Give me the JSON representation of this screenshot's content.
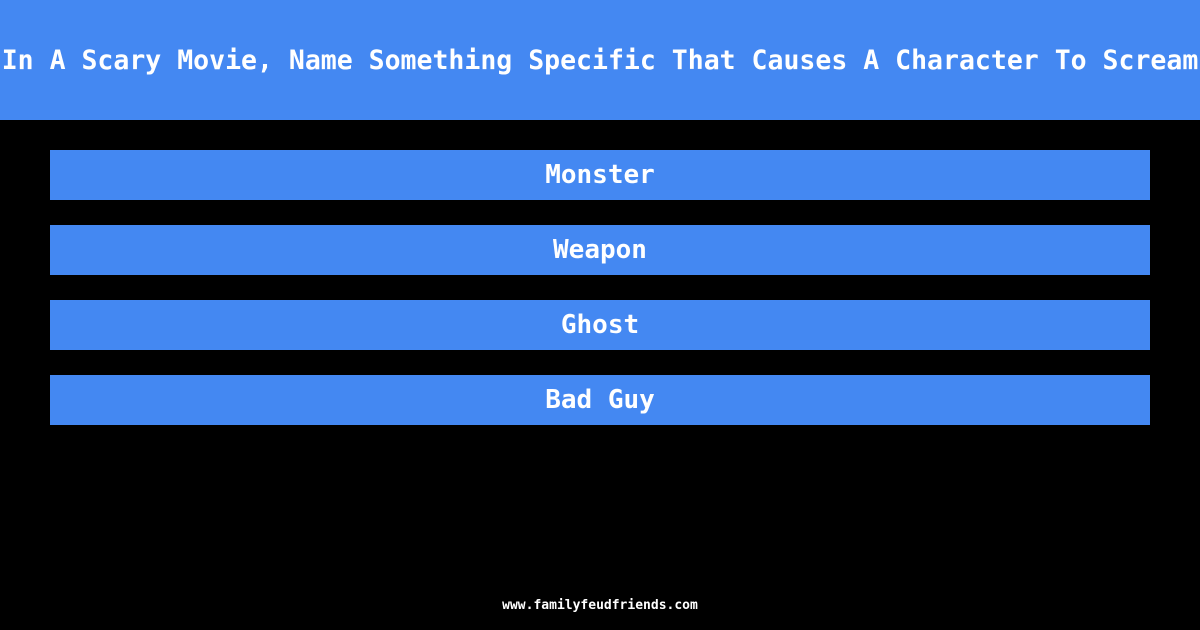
{
  "header": {
    "title": "In A Scary Movie, Name Something Specific That Causes A Character To Scream"
  },
  "answers": [
    {
      "label": "Monster"
    },
    {
      "label": "Weapon"
    },
    {
      "label": "Ghost"
    },
    {
      "label": "Bad Guy"
    }
  ],
  "footer": {
    "site": "www.familyfeudfriends.com"
  },
  "colors": {
    "accent": "#4488f2",
    "background": "#000000",
    "text": "#ffffff"
  }
}
